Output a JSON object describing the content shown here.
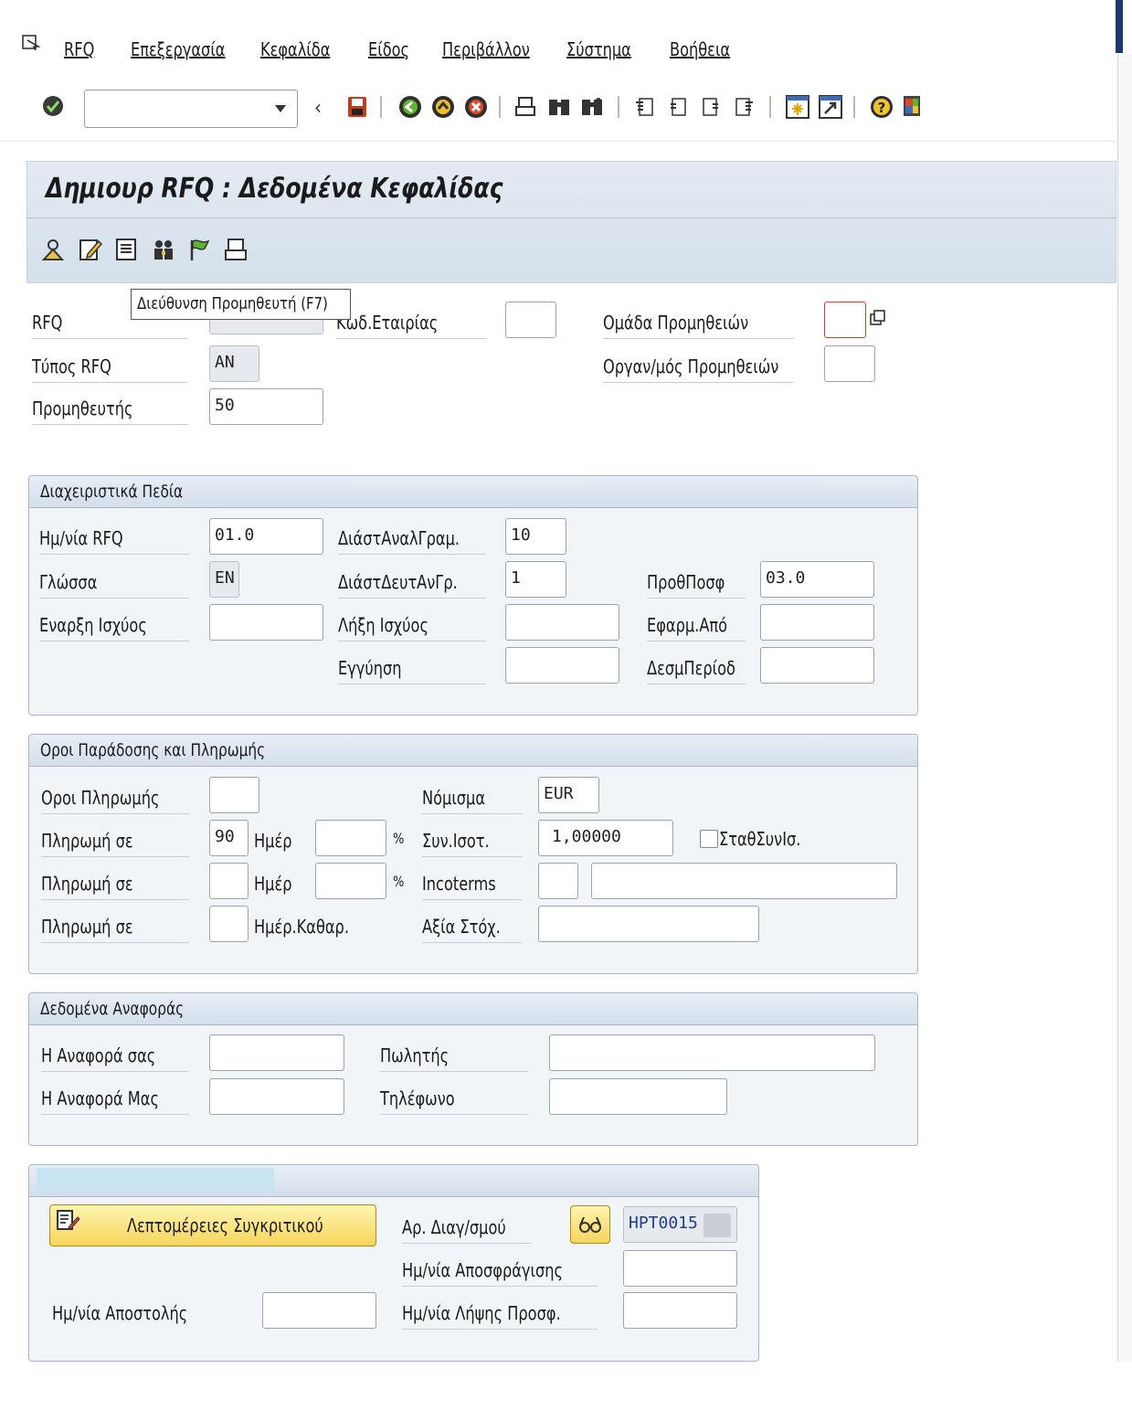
{
  "menu": {
    "items": [
      "RFQ",
      "Επεξεργασία",
      "Κεφαλίδα",
      "Είδος",
      "Περιβάλλον",
      "Σύστημα",
      "Βοήθεια"
    ]
  },
  "title": "Δημιουρ RFQ : Δεδομένα Κεφαλίδας",
  "tooltip": "Διεύθυνση Προμηθευτή   (F7)",
  "header": {
    "rfq_label": "RFQ",
    "company_label": "Κωδ.Εταιρίας",
    "purch_group_label": "Ομάδα Προμηθειών",
    "rfq_type_label": "Τύπος RFQ",
    "rfq_type_value": "AN",
    "purch_org_label": "Οργαν/μός Προμηθειών",
    "vendor_label": "Προμηθευτής",
    "vendor_value": "50"
  },
  "admin": {
    "title": "Διαχειριστικά Πεδία",
    "rfq_date_label": "Ημ/νία RFQ",
    "rfq_date_value": "01.0",
    "item_interval_label": "ΔιάστΑναλΓραμ.",
    "item_interval_value": "10",
    "language_label": "Γλώσσα",
    "language_value": "EN",
    "subitem_interval_label": "ΔιάστΔευτΑνΓρ.",
    "subitem_interval_value": "1",
    "deadline_label": "ΠροθΠοσφ",
    "deadline_value": "03.0",
    "validity_start_label": "Εναρξη Ισχύος",
    "validity_end_label": "Λήξη Ισχύος",
    "apply_by_label": "Εφαρμ.Από",
    "warranty_label": "Εγγύηση",
    "binding_period_label": "ΔεσμΠερίοδ"
  },
  "terms": {
    "title": "Οροι Παράδοσης και Πληρωμής",
    "payment_terms_label": "Οροι Πληρωμής",
    "currency_label": "Νόμισμα",
    "currency_value": "EUR",
    "pay_in_label": "Πληρωμή σε",
    "pay1_days_value": "90",
    "days_label": "Ημέρ",
    "pct": "%",
    "exchange_rate_label": "Συν.Ισοτ.",
    "exchange_rate_value": "1,00000",
    "fixed_rate_label": "ΣταθΣυνΙσ.",
    "incoterms_label": "Incoterms",
    "net_days_label": "Ημέρ.Καθαρ.",
    "target_value_label": "Αξία Στόχ."
  },
  "reference": {
    "title": "Δεδομένα Αναφοράς",
    "your_ref_label": "Η Αναφορά σας",
    "salesperson_label": "Πωλητής",
    "our_ref_label": "Η Αναφορά Μας",
    "phone_label": "Τηλέφωνο"
  },
  "tender": {
    "details_button": "Λεπτομέρειες Συγκριτικού",
    "tender_no_label": "Αρ. Διαγ/σμού",
    "tender_no_value": "HPT0015",
    "unseal_date_label": "Ημ/νία Αποσφράγισης",
    "send_date_label": "Ημ/νία Αποστολής",
    "receipt_date_label": "Ημ/νία Λήψης Προσφ."
  },
  "colors": {
    "title_band": "#dde6ef",
    "group_bg": "#f2f5f8",
    "link_blue": "#1f3f8f"
  }
}
